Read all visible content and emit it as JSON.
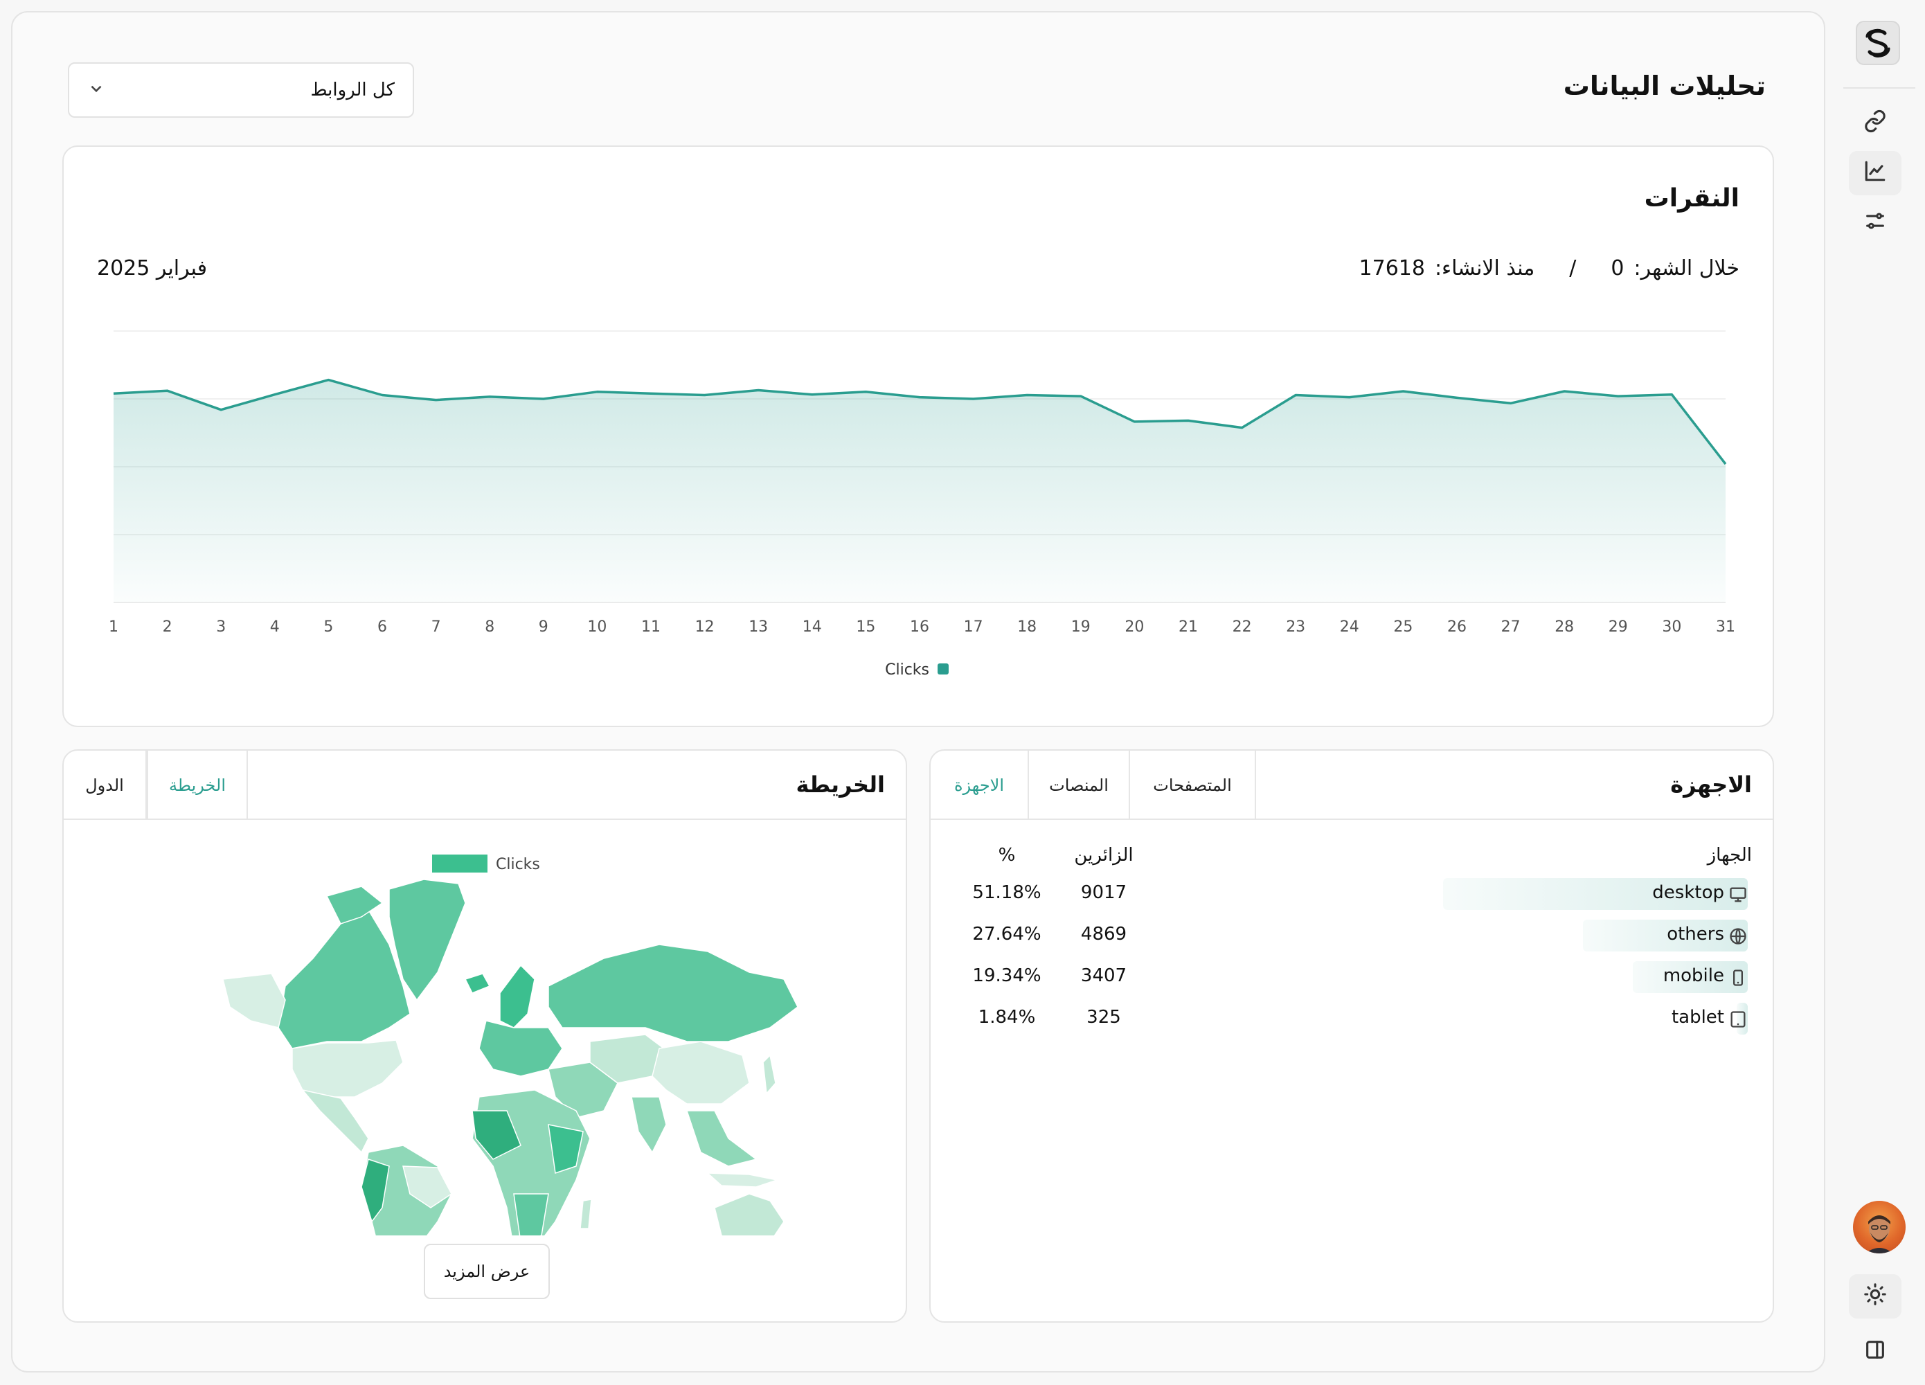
{
  "header": {
    "title": "تحليلات البيانات",
    "links_select": {
      "value": "كل الروابط"
    }
  },
  "sidebar": {
    "items": [
      {
        "name": "links",
        "icon": "link-icon"
      },
      {
        "name": "analytics",
        "icon": "chart-icon"
      },
      {
        "name": "settings",
        "icon": "sliders-icon"
      }
    ],
    "bottom": [
      {
        "name": "theme",
        "icon": "sun-icon"
      },
      {
        "name": "panel",
        "icon": "panel-icon"
      }
    ]
  },
  "clicks_card": {
    "title": "النقرات",
    "month_label": "خلال الشهر:",
    "month_value": "0",
    "separator": "/",
    "since_label": "منذ الانشاء:",
    "since_value": "17618",
    "period": "فبراير 2025"
  },
  "chart_data": {
    "type": "area",
    "x": [
      "1",
      "2",
      "3",
      "4",
      "5",
      "6",
      "7",
      "8",
      "9",
      "10",
      "11",
      "12",
      "13",
      "14",
      "15",
      "16",
      "17",
      "18",
      "19",
      "20",
      "21",
      "22",
      "23",
      "24",
      "25",
      "26",
      "27",
      "28",
      "29",
      "30",
      "31"
    ],
    "series": [
      {
        "name": "Clicks",
        "values": [
          585,
          590,
          555,
          583,
          610,
          582,
          573,
          579,
          575,
          588,
          585,
          582,
          591,
          583,
          588,
          578,
          575,
          582,
          580,
          533,
          535,
          522,
          582,
          578,
          589,
          577,
          567,
          589,
          580,
          583,
          455
        ]
      }
    ],
    "ylim": [
      200,
      700
    ],
    "grid": true,
    "legend_position": "bottom",
    "color": "#2a9d8f"
  },
  "map_card": {
    "title": "الخريطة",
    "tabs": [
      {
        "label": "الخريطة",
        "active": true
      },
      {
        "label": "الدول",
        "active": false
      }
    ],
    "legend_label": "Clicks",
    "legend_color": "#3cbf8f",
    "show_more": "عرض المزيد"
  },
  "devices_card": {
    "title": "الاجهزة",
    "tabs": [
      {
        "label": "الاجهزة",
        "active": true
      },
      {
        "label": "المنصات",
        "active": false
      },
      {
        "label": "المتصفحات",
        "active": false
      }
    ],
    "columns": {
      "device": "الجهاز",
      "visitors": "الزائرين",
      "percent": "%"
    },
    "rows": [
      {
        "name": "desktop",
        "icon": "monitor-icon",
        "visitors": "9017",
        "percent": "51.18%",
        "share": 0.5118
      },
      {
        "name": "others",
        "icon": "globe-icon",
        "visitors": "4869",
        "percent": "27.64%",
        "share": 0.2764
      },
      {
        "name": "mobile",
        "icon": "phone-icon",
        "visitors": "3407",
        "percent": "19.34%",
        "share": 0.1934
      },
      {
        "name": "tablet",
        "icon": "tablet-icon",
        "visitors": "325",
        "percent": "1.84%",
        "share": 0.0184
      }
    ]
  }
}
